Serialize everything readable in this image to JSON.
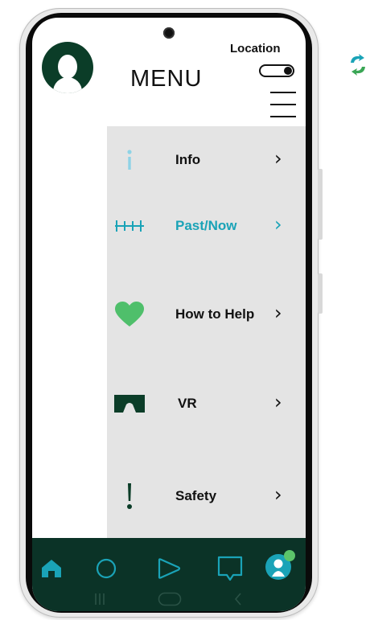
{
  "header": {
    "title": "MENU",
    "location_label": "Location",
    "location_toggle": "on"
  },
  "menu": {
    "items": [
      {
        "label": "Info",
        "icon": "info-icon",
        "active": false
      },
      {
        "label": "Past/Now",
        "icon": "timeline-icon",
        "active": true
      },
      {
        "label": "How to Help",
        "icon": "heart-icon",
        "active": false
      },
      {
        "label": "VR",
        "icon": "vr-headset-icon",
        "active": false
      },
      {
        "label": "Safety",
        "icon": "exclamation-icon",
        "active": false
      }
    ]
  },
  "bottom_nav": {
    "items": [
      "home-icon",
      "circle-icon",
      "play-icon",
      "chat-icon",
      "profile-icon"
    ],
    "system": [
      "recent-apps-icon",
      "home-pill-icon",
      "back-icon"
    ]
  },
  "colors": {
    "brand_dark_green": "#0b3327",
    "accent_teal": "#1aa3b7",
    "heart_green": "#4fbf6b",
    "panel_gray": "#e4e4e4",
    "notification_dot": "#5cc46a"
  }
}
